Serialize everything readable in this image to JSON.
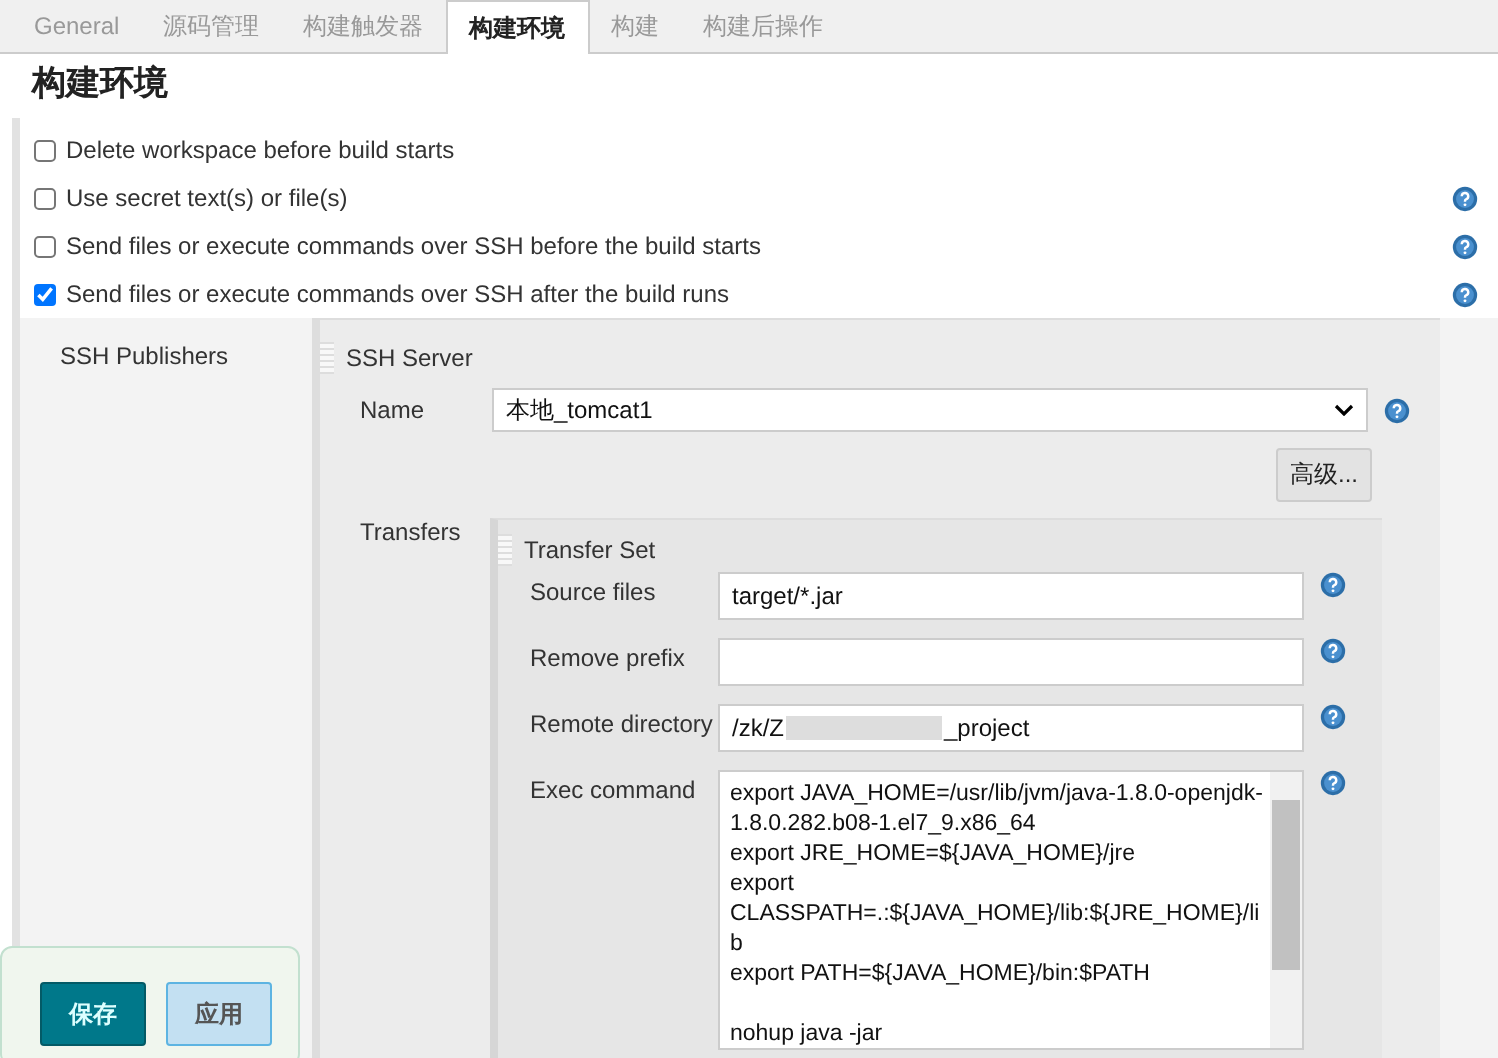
{
  "tabs": [
    {
      "label": "General",
      "selected": false
    },
    {
      "label": "源码管理",
      "selected": false
    },
    {
      "label": "构建触发器",
      "selected": false
    },
    {
      "label": "构建环境",
      "selected": true
    },
    {
      "label": "构建",
      "selected": false
    },
    {
      "label": "构建后操作",
      "selected": false
    }
  ],
  "section_title": "构建环境",
  "options": [
    {
      "label": "Delete workspace before build starts",
      "checked": false,
      "help": false
    },
    {
      "label": "Use secret text(s) or file(s)",
      "checked": false,
      "help": true
    },
    {
      "label": "Send files or execute commands over SSH before the build starts",
      "checked": false,
      "help": true
    },
    {
      "label": "Send files or execute commands over SSH after the build runs",
      "checked": true,
      "help": true
    }
  ],
  "ssh_publishers": {
    "label": "SSH Publishers",
    "server_title": "SSH Server",
    "name_label": "Name",
    "name_value": "本地_tomcat1",
    "advanced_button": "高级...",
    "transfers_label": "Transfers",
    "transfer_set": {
      "title": "Transfer Set",
      "fields": [
        {
          "kind": "input",
          "label": "Source files",
          "value": "target/*.jar"
        },
        {
          "kind": "input",
          "label": "Remove prefix"
        },
        {
          "kind": "redacted",
          "label": "Remote directory",
          "value": "/zk/Z",
          "value_end": "_project"
        },
        {
          "kind": "textarea",
          "label": "Exec command",
          "value": "export JAVA_HOME=/usr/lib/jvm/java-1.8.0-openjdk-1.8.0.282.b08-1.el7_9.x86_64\nexport JRE_HOME=${JAVA_HOME}/jre\nexport CLASSPATH=.:${JAVA_HOME}/lib:${JRE_HOME}/lib\nexport PATH=${JAVA_HOME}/bin:$PATH\n\nnohup java -jar"
        }
      ]
    }
  },
  "buttons": [
    {
      "label": "保存",
      "kind": "primary"
    },
    {
      "label": "应用",
      "kind": "secondary"
    }
  ]
}
